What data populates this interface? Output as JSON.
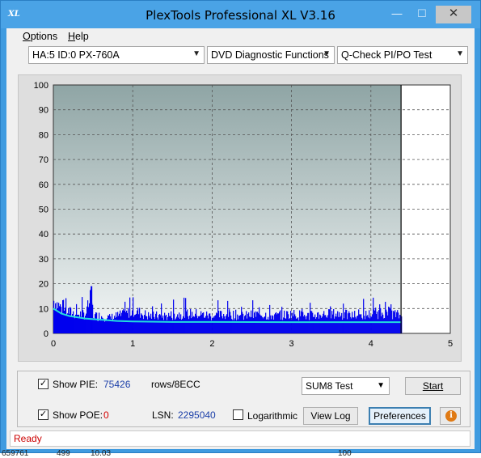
{
  "window": {
    "title": "PlexTools Professional XL V3.16",
    "icon_text": "XL",
    "minimize": "—",
    "maximize": "☐",
    "close": "✕"
  },
  "menu": [
    {
      "label": "Options",
      "accel": "O",
      "rest": "ptions"
    },
    {
      "label": "Help",
      "accel": "H",
      "rest": "elp"
    }
  ],
  "toolbar": {
    "drive": "HA:5 ID:0  PX-760A",
    "function": "DVD Diagnostic Functions",
    "test": "Q-Check PI/PO Test"
  },
  "chart_data": {
    "type": "bar",
    "xlim": [
      0,
      5
    ],
    "ylim": [
      0,
      100
    ],
    "x_ticks": [
      "0",
      "1",
      "2",
      "3",
      "4",
      "5"
    ],
    "y_ticks": [
      "0",
      "10",
      "20",
      "30",
      "40",
      "50",
      "60",
      "70",
      "80",
      "90",
      "100"
    ],
    "grid": true,
    "scan_end_x": 4.38,
    "series": [
      {
        "name": "PIE",
        "color": "#0000ee",
        "description_of_shape": "dense bars",
        "x": [
          0.0,
          0.1,
          0.2,
          0.3,
          0.4,
          0.47,
          0.5,
          0.6,
          0.7,
          0.8,
          0.9,
          1.0,
          1.2,
          1.4,
          1.6,
          1.8,
          2.0,
          2.2,
          2.4,
          2.6,
          2.8,
          3.0,
          3.2,
          3.4,
          3.6,
          3.8,
          4.0,
          4.2,
          4.38
        ],
        "values": [
          17,
          13,
          11,
          10,
          10,
          19,
          9,
          9,
          8,
          9,
          10,
          12,
          9,
          9,
          10,
          10,
          9,
          10,
          9,
          10,
          9,
          10,
          9,
          10,
          10,
          9,
          10,
          11,
          9
        ]
      },
      {
        "name": "Average",
        "color": "#22dddd",
        "x": [
          0.0,
          0.1,
          0.2,
          0.4,
          0.6,
          0.8,
          1.0,
          1.5,
          2.0,
          3.0,
          4.0,
          4.38
        ],
        "values": [
          10,
          8,
          7,
          6,
          5.5,
          5,
          4.8,
          4.6,
          4.6,
          4.5,
          4.5,
          4.5
        ]
      }
    ]
  },
  "bottom": {
    "show_pie_label": "Show PIE:",
    "show_pie_checked": "✓",
    "pie_value": "75426",
    "rows_label": "rows/8ECC",
    "show_poe_label": "Show POE:",
    "show_poe_checked": "✓",
    "poe_value": "0",
    "lsn_label": "LSN:",
    "lsn_value": "2295040",
    "log_label": "Logarithmic",
    "test_select": "SUM8 Test",
    "start": "Start",
    "view_log": "View Log",
    "preferences": "Preferences",
    "info": "i"
  },
  "status": "Ready",
  "behind": [
    "659761",
    "499",
    "10.03",
    "100"
  ]
}
